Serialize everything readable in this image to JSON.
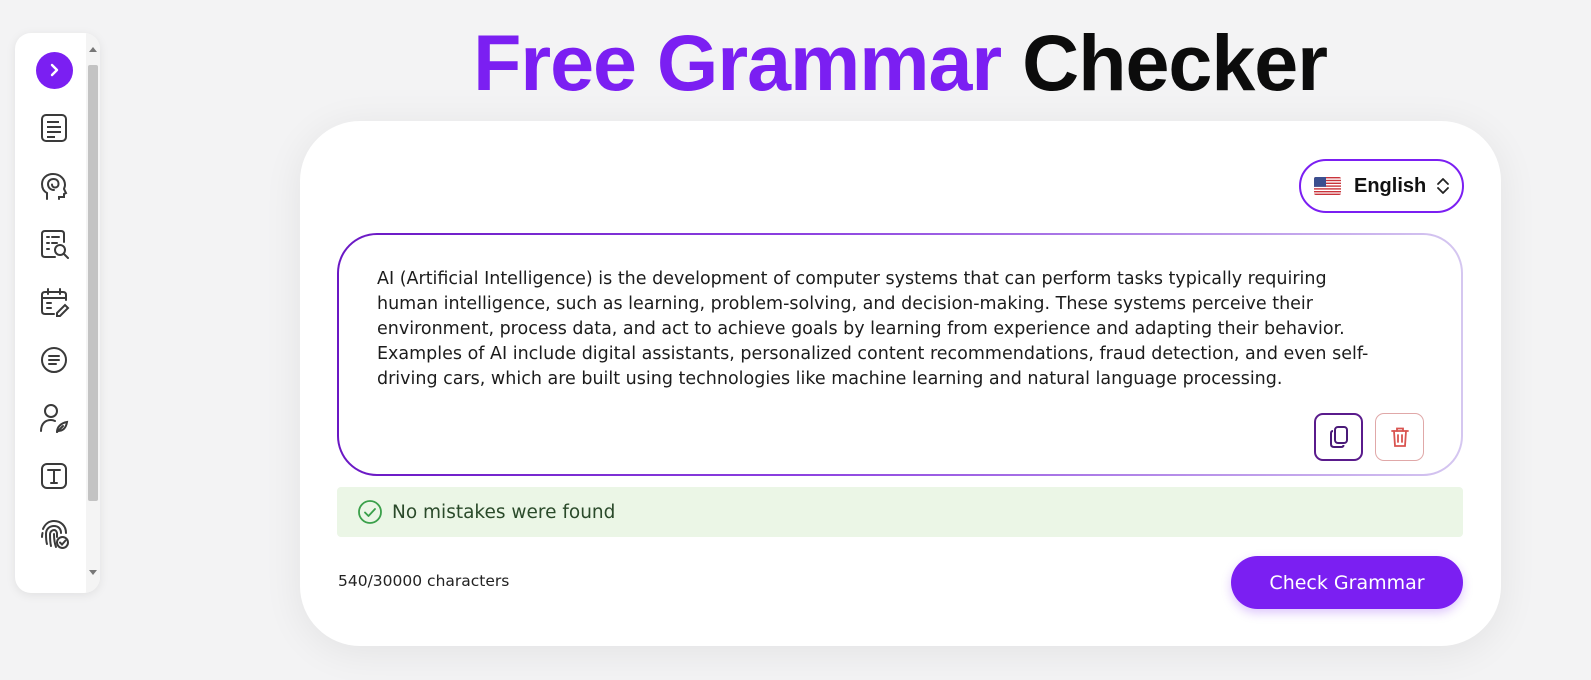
{
  "title": {
    "part1": "Free Grammar",
    "part2": "Checker"
  },
  "sidebar": {
    "items": [
      {
        "icon": "chevron-right-icon"
      },
      {
        "icon": "document-icon"
      },
      {
        "icon": "brain-icon"
      },
      {
        "icon": "document-search-icon"
      },
      {
        "icon": "calendar-edit-icon"
      },
      {
        "icon": "text-circle-icon"
      },
      {
        "icon": "user-write-icon"
      },
      {
        "icon": "text-box-icon"
      },
      {
        "icon": "fingerprint-check-icon"
      }
    ]
  },
  "language": {
    "label": "English",
    "flag": "us-flag-icon"
  },
  "editor": {
    "text": "AI (Artificial Intelligence) is the development of computer systems that can perform tasks typically requiring human intelligence, such as learning, problem-solving, and decision-making. These systems perceive their environment, process data, and act to achieve goals by learning from experience and adapting their behavior. Examples of AI include digital assistants, personalized content recommendations, fraud detection, and even self-driving cars, which are built using technologies like machine learning and natural language processing."
  },
  "status": {
    "message": "No mistakes were found"
  },
  "footer": {
    "char_count": "540/30000 characters",
    "check_button": "Check Grammar"
  },
  "colors": {
    "accent": "#7b1ff2",
    "success_bg": "#ebf6e6",
    "success_icon": "#3aa04a",
    "delete": "#d9534f"
  }
}
